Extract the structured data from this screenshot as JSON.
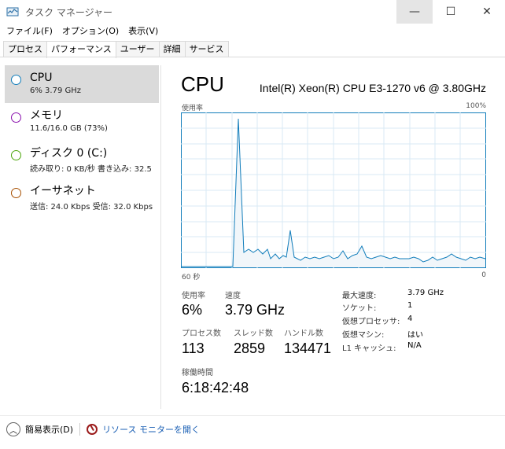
{
  "window": {
    "title": "タスク マネージャー",
    "controls": {
      "minimize": "—",
      "maximize": "☐",
      "close": "✕"
    }
  },
  "menu": [
    "ファイル(F)",
    "オプション(O)",
    "表示(V)"
  ],
  "tabs": [
    "プロセス",
    "パフォーマンス",
    "ユーザー",
    "詳細",
    "サービス"
  ],
  "active_tab": "パフォーマンス",
  "sidebar": {
    "items": [
      {
        "name": "CPU",
        "sub": "6%  3.79 GHz",
        "color": "#117dbb",
        "selected": true
      },
      {
        "name": "メモリ",
        "sub": "11.6/16.0 GB (73%)",
        "color": "#8b12ae",
        "selected": false
      },
      {
        "name": "ディスク 0 (C:)",
        "sub": "読み取り: 0 KB/秒 書き込み: 32.5",
        "color": "#4da60c",
        "selected": false
      },
      {
        "name": "イーサネット",
        "sub": "送信: 24.0 Kbps 受信: 32.0 Kbps",
        "color": "#a74f01",
        "selected": false
      }
    ]
  },
  "main": {
    "title": "CPU",
    "model": "Intel(R) Xeon(R) CPU E3-1270 v6 @ 3.80GHz",
    "graph": {
      "top_left": "使用率",
      "top_right": "100%",
      "bottom_left": "60 秒",
      "bottom_right": "0",
      "accent": "#117dbb",
      "fill": "#f1f6fa",
      "grid": "#d9eaf4"
    },
    "stats": {
      "usage_label": "使用率",
      "usage_value": "6%",
      "speed_label": "速度",
      "speed_value": "3.79 GHz",
      "processes_label": "プロセス数",
      "processes_value": "113",
      "threads_label": "スレッド数",
      "threads_value": "2859",
      "handles_label": "ハンドル数",
      "handles_value": "134471",
      "uptime_label": "稼働時間",
      "uptime_value": "6:18:42:48"
    },
    "specs": [
      {
        "k": "最大速度:",
        "v": "3.79 GHz"
      },
      {
        "k": "ソケット:",
        "v": "1"
      },
      {
        "k": "仮想プロセッサ:",
        "v": "4"
      },
      {
        "k": "仮想マシン:",
        "v": "はい"
      },
      {
        "k": "L1 キャッシュ:",
        "v": "N/A"
      }
    ]
  },
  "footer": {
    "fewer_details": "簡易表示(D)",
    "resource_monitor": "リソース モニターを開く"
  }
}
